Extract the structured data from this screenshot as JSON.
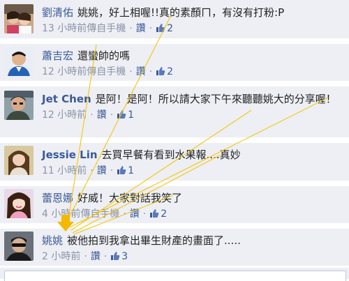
{
  "comments": [
    {
      "author": "劉清佑",
      "text": "姚姚，好上相喔!!真的素顏ㄇ，有沒有打粉:P",
      "time": "13 小時前傳自手機",
      "like_label": "讚",
      "like_count": "2"
    },
    {
      "author": "蕭吉宏",
      "text": "還蠻帥的嗎",
      "time": "12 小時前傳自手機",
      "like_label": "讚",
      "like_count": "2"
    },
    {
      "author": "Jet Chen",
      "text": "是阿！是阿！所以請大家下午來聽聽姚大的分享喔！",
      "time": "12 小時前",
      "like_label": "讚",
      "like_count": "1"
    },
    {
      "author": "Jessie Lin",
      "text": "去買早餐有看到水果報....真妙",
      "time": "11 小時前",
      "like_label": "讚",
      "like_count": "1"
    },
    {
      "author": "蕾恩娜",
      "text": "好威！大家對話我笑了",
      "time": "4 小時前傳自手機",
      "like_label": "讚",
      "like_count": "2"
    },
    {
      "author": "姚姚",
      "text": "被他拍到我拿出畢生財產的畫面了.....",
      "time": "2 小時前",
      "like_label": "讚",
      "like_count": "3"
    }
  ],
  "colors": {
    "link": "#3b5998",
    "meta": "#8b93a6",
    "comment_bg": "#edeff4",
    "annotation_line": "#f5c400",
    "annotation_arrow": "#f5b800"
  },
  "icons": {
    "like": "thumbs-up-icon",
    "annotation": "down-arrow-icon"
  }
}
